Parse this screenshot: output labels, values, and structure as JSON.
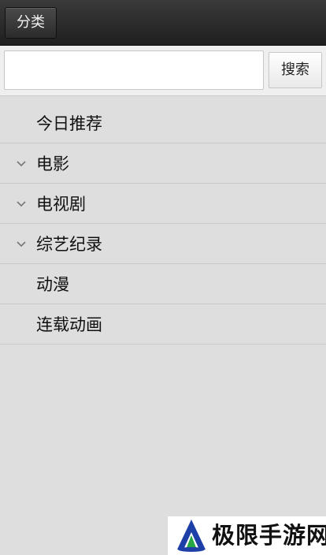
{
  "header": {
    "category_button_label": "分类"
  },
  "search": {
    "value": "",
    "placeholder": "",
    "button_label": "搜索"
  },
  "menu": {
    "items": [
      {
        "label": "今日推荐",
        "expandable": false
      },
      {
        "label": "电影",
        "expandable": true
      },
      {
        "label": "电视剧",
        "expandable": true
      },
      {
        "label": "综艺纪录",
        "expandable": true
      },
      {
        "label": "动漫",
        "expandable": false
      },
      {
        "label": "连载动画",
        "expandable": false
      }
    ]
  },
  "watermark": {
    "text": "极限手游网"
  },
  "colors": {
    "topbar": "#2b2b2b",
    "background": "#dedede",
    "divider": "#c8c8c8",
    "chevron": "#777777",
    "logo_blue": "#1f3fa8",
    "logo_green": "#28a745"
  }
}
